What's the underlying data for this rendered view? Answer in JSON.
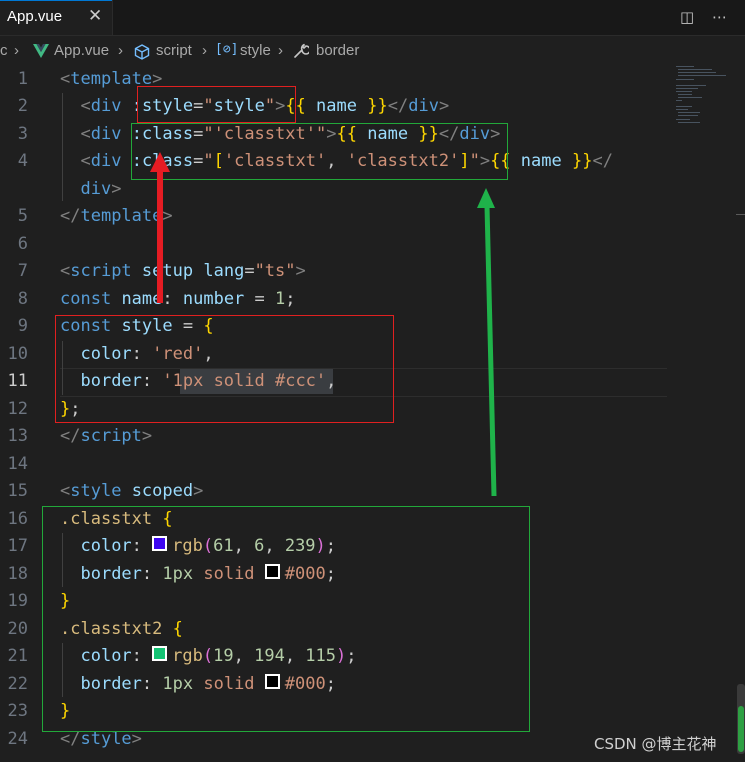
{
  "tab": {
    "title": "App.vue",
    "close": "✕"
  },
  "actions": {
    "split": "◫",
    "more": "⋯"
  },
  "breadcrumb": {
    "lead": "c",
    "sep": "›",
    "file": "App.vue",
    "script": "script",
    "style": "style",
    "border": "border"
  },
  "code": {
    "line_numbers": [
      "1",
      "2",
      "3",
      "4",
      "5",
      "6",
      "7",
      "8",
      "9",
      "10",
      "11",
      "12",
      "13",
      "14",
      "15",
      "16",
      "17",
      "18",
      "19",
      "20",
      "21",
      "22",
      "23",
      "24"
    ],
    "current_line": "11",
    "swatches": {
      "c1": "#3d06ef",
      "c2": "#13c273",
      "c3": "#000000",
      "c4": "#000000"
    }
  },
  "colors": {
    "red_box": "#e02020",
    "green_box": "#22a83a",
    "red_arrow": "#e51c23",
    "green_arrow": "#1fb34a"
  },
  "icons": [
    "close-icon",
    "split-editor-icon",
    "more-actions-icon",
    "vue-icon",
    "cube-icon",
    "brackets-icon",
    "wrench-icon"
  ],
  "watermark": "CSDN @博主花神"
}
